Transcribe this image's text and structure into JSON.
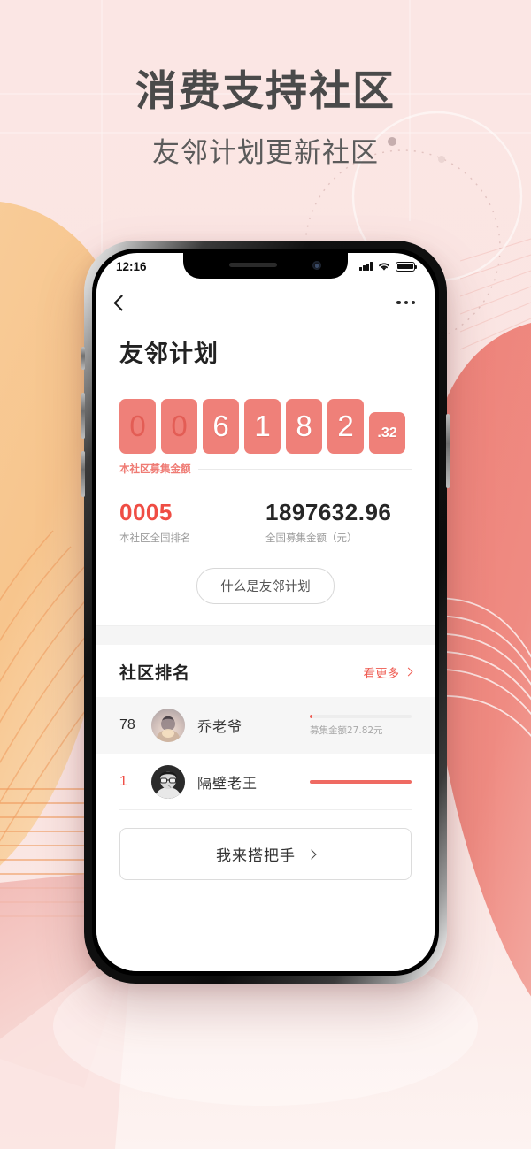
{
  "poster": {
    "headline": "消费支持社区",
    "subheadline": "友邻计划更新社区",
    "bg_color": "#fbe6e4",
    "accent_color": "#ef5a50",
    "peach_color": "#f5c58c"
  },
  "status_bar": {
    "time": "12:16",
    "signal_icon": "cellular-bars-icon",
    "wifi_icon": "wifi-icon",
    "battery_icon": "battery-full-icon"
  },
  "navbar": {
    "back_icon": "back-chevron-icon",
    "more_icon": "more-dots-icon"
  },
  "app": {
    "page_title": "友邻计划",
    "counter": {
      "digits": [
        {
          "char": "0",
          "dim": true
        },
        {
          "char": "0",
          "dim": true
        },
        {
          "char": "6",
          "dim": false
        },
        {
          "char": "1",
          "dim": false
        },
        {
          "char": "8",
          "dim": false
        },
        {
          "char": "2",
          "dim": false
        }
      ],
      "fraction": ".32",
      "tile_color": "#ef8079",
      "label": "本社区募集金额"
    },
    "stats": [
      {
        "value": "0005",
        "label": "本社区全国排名",
        "color": "red"
      },
      {
        "value": "1897632.96",
        "label": "全国募集金额（元）",
        "color": "dark"
      }
    ],
    "explain_button": "什么是友邻计划",
    "ranking": {
      "title": "社区排名",
      "more_label": "看更多",
      "more_icon": "chevron-right-icon",
      "rows": [
        {
          "rank": "78",
          "name": "乔老爷",
          "avatar": "avatar-portrait-woman",
          "amount_label": "募集金额27.82元",
          "progress": 3,
          "highlight": true,
          "rank_color": "dark"
        },
        {
          "rank": "1",
          "name": "隔壁老王",
          "avatar": "avatar-portrait-man-glasses",
          "amount_label": "",
          "progress": 100,
          "highlight": false,
          "rank_color": "red"
        }
      ]
    },
    "cta_button": {
      "label": "我来搭把手",
      "icon": "chevron-right-icon"
    }
  }
}
